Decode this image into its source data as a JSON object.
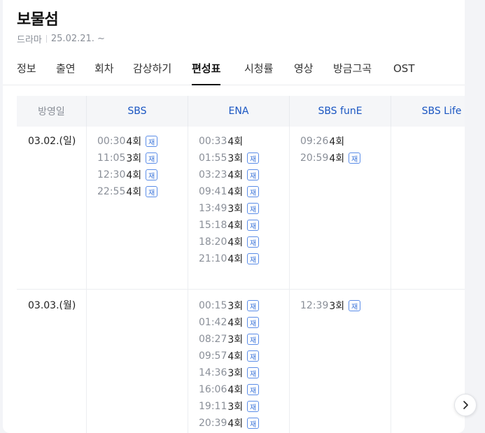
{
  "program": {
    "title": "보물섬",
    "genre": "드라마",
    "air_date": "25.02.21. ~"
  },
  "tabs": [
    {
      "label": "정보"
    },
    {
      "label": "출연"
    },
    {
      "label": "회차"
    },
    {
      "label": "감상하기"
    },
    {
      "label": "편성표",
      "active": true
    },
    {
      "label": "시청률"
    },
    {
      "label": "영상"
    },
    {
      "label": "방금그곡"
    },
    {
      "label": "OST"
    }
  ],
  "schedule": {
    "date_header": "방영일",
    "channels": [
      "SBS",
      "ENA",
      "SBS funE",
      "SBS Life"
    ],
    "rerun_badge": "재",
    "days": [
      {
        "date": "03.02.(일)",
        "slots": [
          [
            {
              "time": "00:30",
              "ep": "4회",
              "rerun": true
            },
            {
              "time": "11:05",
              "ep": "3회",
              "rerun": true
            },
            {
              "time": "12:30",
              "ep": "4회",
              "rerun": true
            },
            {
              "time": "22:55",
              "ep": "4회",
              "rerun": true
            }
          ],
          [
            {
              "time": "00:33",
              "ep": "4회",
              "rerun": false
            },
            {
              "time": "01:55",
              "ep": "3회",
              "rerun": true
            },
            {
              "time": "03:23",
              "ep": "4회",
              "rerun": true
            },
            {
              "time": "09:41",
              "ep": "4회",
              "rerun": true
            },
            {
              "time": "13:49",
              "ep": "3회",
              "rerun": true
            },
            {
              "time": "15:18",
              "ep": "4회",
              "rerun": true
            },
            {
              "time": "18:20",
              "ep": "4회",
              "rerun": true
            },
            {
              "time": "21:10",
              "ep": "4회",
              "rerun": true
            }
          ],
          [
            {
              "time": "09:26",
              "ep": "4회",
              "rerun": false
            },
            {
              "time": "20:59",
              "ep": "4회",
              "rerun": true
            }
          ],
          []
        ]
      },
      {
        "date": "03.03.(월)",
        "slots": [
          [],
          [
            {
              "time": "00:15",
              "ep": "3회",
              "rerun": true
            },
            {
              "time": "01:42",
              "ep": "4회",
              "rerun": true
            },
            {
              "time": "08:27",
              "ep": "3회",
              "rerun": true
            },
            {
              "time": "09:57",
              "ep": "4회",
              "rerun": true
            },
            {
              "time": "14:36",
              "ep": "3회",
              "rerun": true
            },
            {
              "time": "16:06",
              "ep": "4회",
              "rerun": true
            },
            {
              "time": "19:11",
              "ep": "3회",
              "rerun": true
            },
            {
              "time": "20:39",
              "ep": "4회",
              "rerun": true
            }
          ],
          [
            {
              "time": "12:39",
              "ep": "3회",
              "rerun": true
            }
          ],
          []
        ]
      }
    ]
  },
  "icons": {
    "next": "chevron-right-icon"
  },
  "colors": {
    "channel": "#1a56c2",
    "rerun_badge": "#3b74d9",
    "muted": "#8a8f98"
  }
}
